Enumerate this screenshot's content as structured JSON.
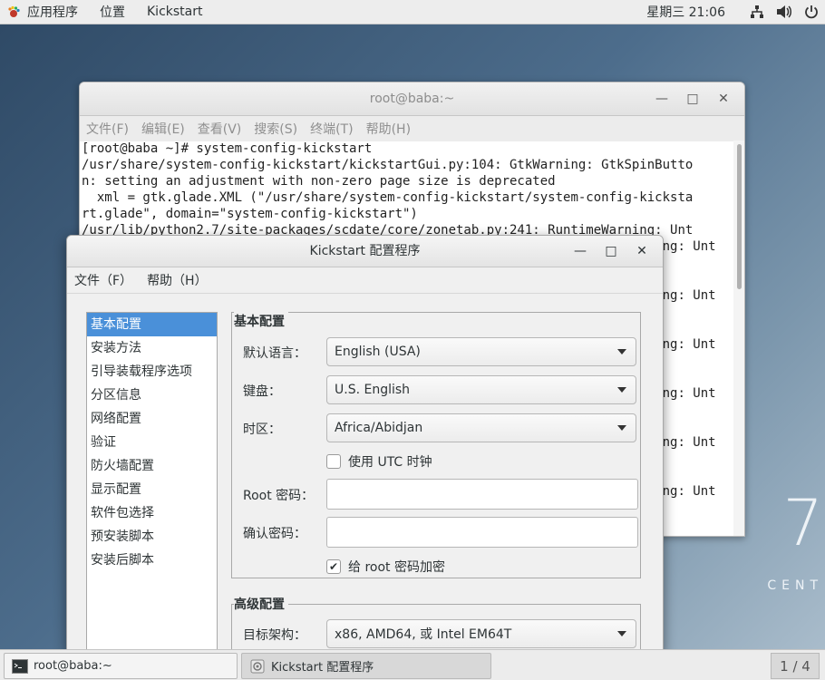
{
  "topbar": {
    "apps_label": "应用程序",
    "places_label": "位置",
    "app_name": "Kickstart",
    "clock": "星期三 21:06"
  },
  "terminal": {
    "title": "root@baba:~",
    "menu": [
      "文件(F)",
      "编辑(E)",
      "查看(V)",
      "搜索(S)",
      "终端(T)",
      "帮助(H)"
    ],
    "lines": [
      "[root@baba ~]# system-config-kickstart",
      "/usr/share/system-config-kickstart/kickstartGui.py:104: GtkWarning: GtkSpinButto",
      "n: setting an adjustment with non-zero page size is deprecated",
      "  xml = gtk.glade.XML (\"/usr/share/system-config-kickstart/system-config-kicksta",
      "rt.glade\", domain=\"system-config-kickstart\")",
      "/usr/lib/python2.7/site-packages/scdate/core/zonetab.py:241: RuntimeWarning: Unt",
      "                                                                          ning: Unt",
      "",
      "",
      "                                                                          ning: Unt",
      "",
      "",
      "                                                                          ning: Unt",
      "",
      "",
      "                                                                          ning: Unt",
      "",
      "",
      "                                                                          ning: Unt",
      "",
      "",
      "                                                                          ning: Unt"
    ]
  },
  "kickstart": {
    "title": "Kickstart 配置程序",
    "menu": {
      "file": "文件（F）",
      "help": "帮助（H）"
    },
    "nav": [
      "基本配置",
      "安装方法",
      "引导装载程序选项",
      "分区信息",
      "网络配置",
      "验证",
      "防火墙配置",
      "显示配置",
      "软件包选择",
      "预安装脚本",
      "安装后脚本"
    ],
    "basic_section": "基本配置",
    "language_label": "默认语言：",
    "language_value": "English (USA)",
    "keyboard_label": "键盘：",
    "keyboard_value": "U.S. English",
    "timezone_label": "时区：",
    "timezone_value": "Africa/Abidjan",
    "utc_label": "使用  UTC 时钟",
    "utc_checked": false,
    "root_pw_label": "Root 密码：",
    "root_pw_value": "",
    "confirm_pw_label": "确认密码：",
    "confirm_pw_value": "",
    "encrypt_label": "给  root 密码加密",
    "encrypt_checked": true,
    "advanced_section": "高级配置",
    "arch_label": "目标架构：",
    "arch_value": "x86, AMD64, 或  Intel EM64T"
  },
  "desktop": {
    "watermark_number": "7",
    "watermark_text": "CENT"
  },
  "taskbar": {
    "tasks": [
      "root@baba:~",
      "Kickstart 配置程序"
    ],
    "pager": "1 / 4"
  }
}
